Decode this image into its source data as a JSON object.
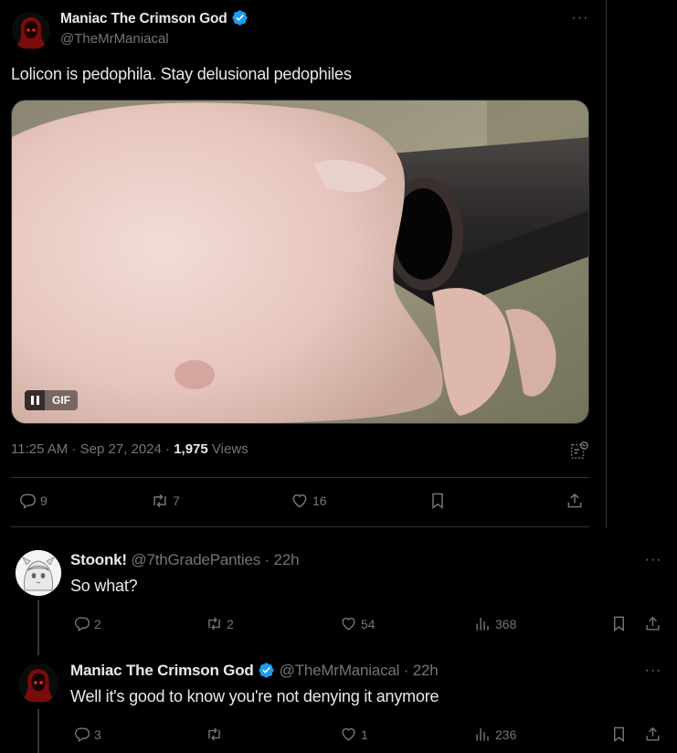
{
  "post": {
    "display_name": "Maniac The Crimson God",
    "handle": "@TheMrManiacal",
    "text": "Lolicon is pedophila. Stay delusional pedophiles",
    "media": {
      "type": "gif",
      "badge_label": "GIF"
    },
    "meta": {
      "time": "11:25 AM",
      "separator": "·",
      "date": "Sep 27, 2024",
      "views_count": "1,975",
      "views_label": "Views"
    },
    "actions": {
      "replies": "9",
      "reposts": "7",
      "likes": "16"
    }
  },
  "replies": [
    {
      "display_name": "Stoonk!",
      "handle": "@7thGradePanties",
      "age": "· 22h",
      "text": "So what?",
      "actions": {
        "replies": "2",
        "reposts": "2",
        "likes": "54",
        "views": "368"
      }
    },
    {
      "display_name": "Maniac The Crimson God",
      "handle": "@TheMrManiacal",
      "age": "· 22h",
      "text": "Well it's good to know you're not denying it anymore",
      "actions": {
        "replies": "3",
        "reposts": "",
        "likes": "1",
        "views": "236"
      }
    }
  ],
  "icons": {
    "verified": "verified-badge-icon",
    "reply": "reply-icon",
    "repost": "repost-icon",
    "like": "heart-icon",
    "views": "views-icon",
    "bookmark": "bookmark-icon",
    "share": "share-icon",
    "more": "more-icon"
  },
  "colors": {
    "background": "#000000",
    "text": "#e7e9ea",
    "muted": "#71767b",
    "verified": "#1d9bf0",
    "divider": "#2f3336"
  }
}
